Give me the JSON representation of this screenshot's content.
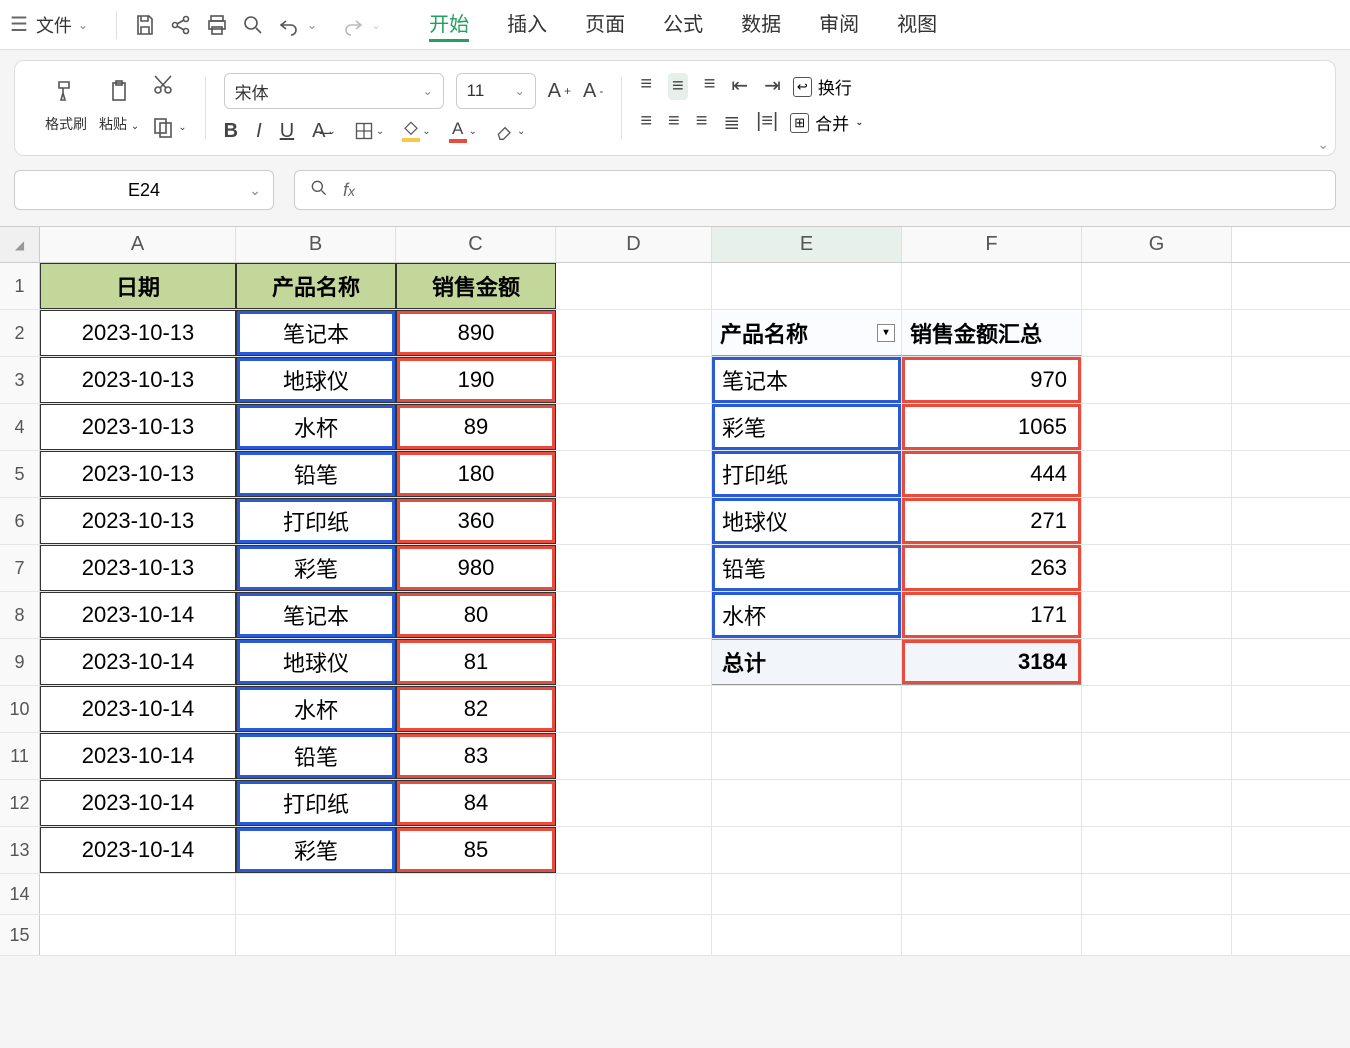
{
  "menu": {
    "file": "文件",
    "tabs": [
      "开始",
      "插入",
      "页面",
      "公式",
      "数据",
      "审阅",
      "视图"
    ],
    "active_tab": 0
  },
  "ribbon": {
    "format_painter": "格式刷",
    "paste": "粘贴",
    "font_name": "宋体",
    "font_size": "11",
    "wrap_text": "换行",
    "merge": "合并"
  },
  "namebox": "E24",
  "columns": [
    "A",
    "B",
    "C",
    "D",
    "E",
    "F",
    "G"
  ],
  "selected_col": "E",
  "table": {
    "headers": {
      "A": "日期",
      "B": "产品名称",
      "C": "销售金额"
    },
    "rows": [
      {
        "A": "2023-10-13",
        "B": "笔记本",
        "C": "890"
      },
      {
        "A": "2023-10-13",
        "B": "地球仪",
        "C": "190"
      },
      {
        "A": "2023-10-13",
        "B": "水杯",
        "C": "89"
      },
      {
        "A": "2023-10-13",
        "B": "铅笔",
        "C": "180"
      },
      {
        "A": "2023-10-13",
        "B": "打印纸",
        "C": "360"
      },
      {
        "A": "2023-10-13",
        "B": "彩笔",
        "C": "980"
      },
      {
        "A": "2023-10-14",
        "B": "笔记本",
        "C": "80"
      },
      {
        "A": "2023-10-14",
        "B": "地球仪",
        "C": "81"
      },
      {
        "A": "2023-10-14",
        "B": "水杯",
        "C": "82"
      },
      {
        "A": "2023-10-14",
        "B": "铅笔",
        "C": "83"
      },
      {
        "A": "2023-10-14",
        "B": "打印纸",
        "C": "84"
      },
      {
        "A": "2023-10-14",
        "B": "彩笔",
        "C": "85"
      }
    ]
  },
  "pivot": {
    "header_name": "产品名称",
    "header_value": "销售金额汇总",
    "rows": [
      {
        "name": "笔记本",
        "value": "970"
      },
      {
        "name": "彩笔",
        "value": "1065"
      },
      {
        "name": "打印纸",
        "value": "444"
      },
      {
        "name": "地球仪",
        "value": "271"
      },
      {
        "name": "铅笔",
        "value": "263"
      },
      {
        "name": "水杯",
        "value": "171"
      }
    ],
    "total_label": "总计",
    "total_value": "3184"
  },
  "chart_data": {
    "type": "table",
    "note": "Spreadsheet with source data (cols A-C) and pivot summary (cols E-F).",
    "source": {
      "columns": [
        "日期",
        "产品名称",
        "销售金额"
      ],
      "rows": [
        [
          "2023-10-13",
          "笔记本",
          890
        ],
        [
          "2023-10-13",
          "地球仪",
          190
        ],
        [
          "2023-10-13",
          "水杯",
          89
        ],
        [
          "2023-10-13",
          "铅笔",
          180
        ],
        [
          "2023-10-13",
          "打印纸",
          360
        ],
        [
          "2023-10-13",
          "彩笔",
          980
        ],
        [
          "2023-10-14",
          "笔记本",
          80
        ],
        [
          "2023-10-14",
          "地球仪",
          81
        ],
        [
          "2023-10-14",
          "水杯",
          82
        ],
        [
          "2023-10-14",
          "铅笔",
          83
        ],
        [
          "2023-10-14",
          "打印纸",
          84
        ],
        [
          "2023-10-14",
          "彩笔",
          85
        ]
      ]
    },
    "pivot": {
      "group_by": "产品名称",
      "aggregate": "销售金额汇总",
      "rows": [
        {
          "产品名称": "笔记本",
          "销售金额汇总": 970
        },
        {
          "产品名称": "彩笔",
          "销售金额汇总": 1065
        },
        {
          "产品名称": "打印纸",
          "销售金额汇总": 444
        },
        {
          "产品名称": "地球仪",
          "销售金额汇总": 271
        },
        {
          "产品名称": "铅笔",
          "销售金额汇总": 263
        },
        {
          "产品名称": "水杯",
          "销售金额汇总": 171
        }
      ],
      "total": 3184
    }
  }
}
